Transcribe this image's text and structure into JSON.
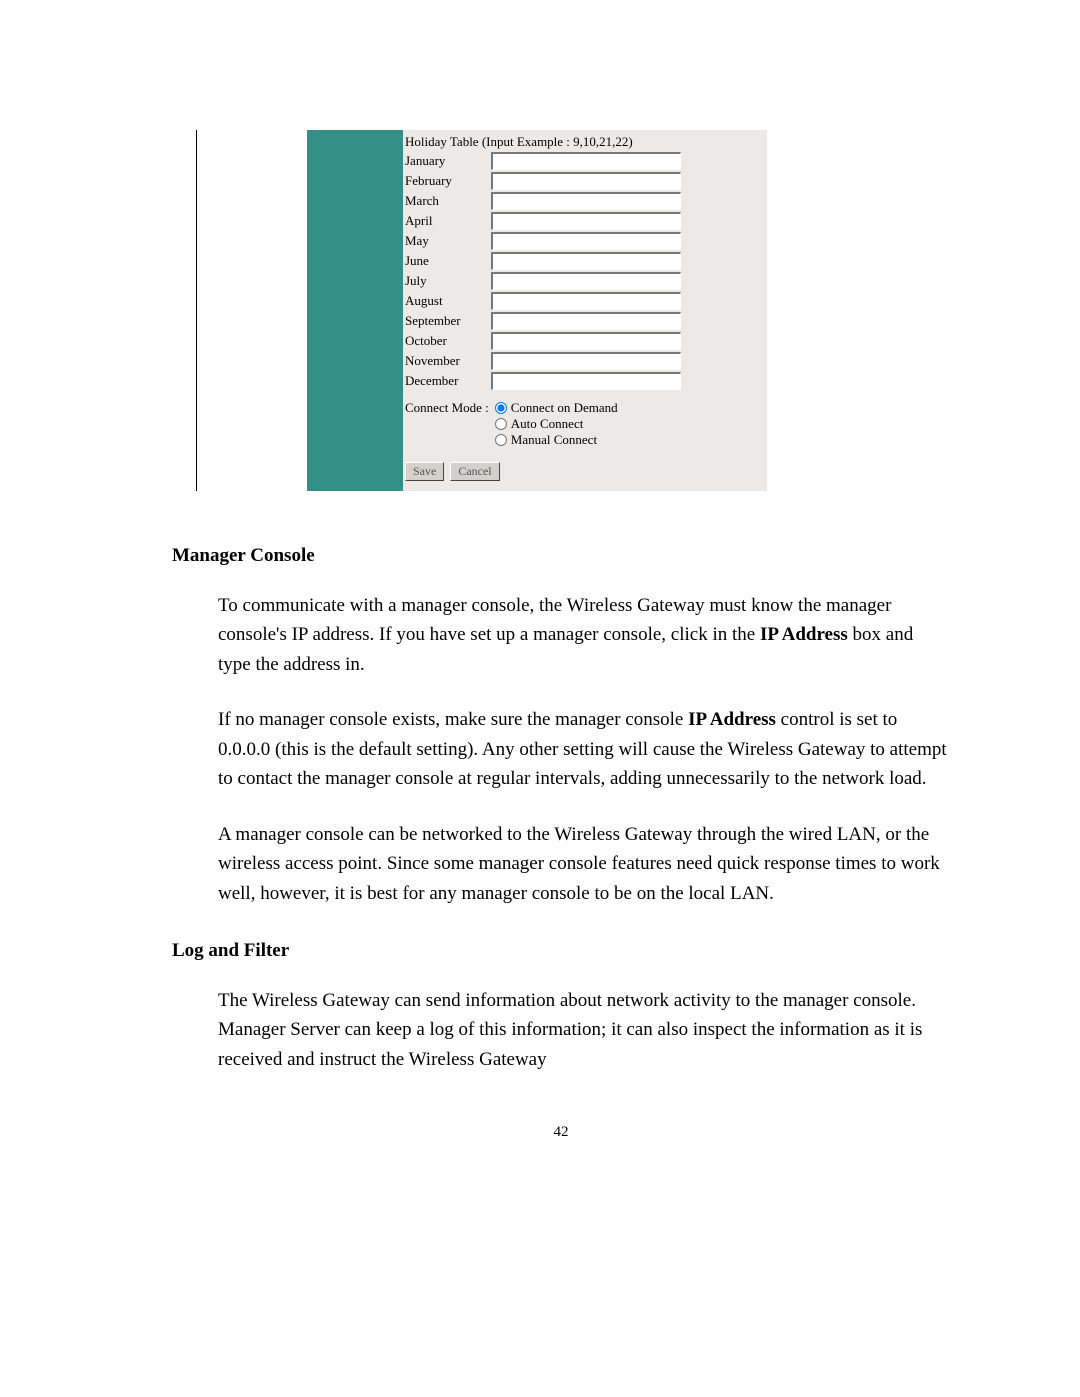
{
  "figure": {
    "holiday_title": "Holiday Table (Input Example : 9,10,21,22)",
    "months": [
      {
        "label": "January",
        "value": ""
      },
      {
        "label": "February",
        "value": ""
      },
      {
        "label": "March",
        "value": ""
      },
      {
        "label": "April",
        "value": ""
      },
      {
        "label": "May",
        "value": ""
      },
      {
        "label": "June",
        "value": ""
      },
      {
        "label": "July",
        "value": ""
      },
      {
        "label": "August",
        "value": ""
      },
      {
        "label": "September",
        "value": ""
      },
      {
        "label": "October",
        "value": ""
      },
      {
        "label": "November",
        "value": ""
      },
      {
        "label": "December",
        "value": ""
      }
    ],
    "connect_mode_label": "Connect Mode :",
    "connect_options": {
      "on_demand": "Connect on Demand",
      "auto": "Auto Connect",
      "manual": "Manual Connect"
    },
    "save_label": "Save",
    "cancel_label": "Cancel"
  },
  "sections": {
    "manager_console": {
      "heading": "Manager Console",
      "p1_a": "To communicate with a manager console, the Wireless Gateway must know the manager console's IP address. If you have set up a manager console, click in the ",
      "p1_bold": "IP Address",
      "p1_b": " box and type the address in.",
      "p2_a": "If no manager console exists, make sure the manager console ",
      "p2_bold": "IP Address",
      "p2_b": " control is set to 0.0.0.0 (this is the default setting). Any other setting will cause the Wireless Gateway to attempt to contact the manager console at regular intervals, adding unnecessarily to the network load.",
      "p3": "A manager console can be networked to the Wireless Gateway through the wired LAN, or the wireless access point. Since some manager console features need quick response times to work well, however, it is best for any manager console to be on the local LAN."
    },
    "log_and_filter": {
      "heading": "Log and Filter",
      "p1": "The Wireless Gateway can send information about network activity to the manager console. Manager Server can keep a log of this information; it can also inspect the information as it is received and instruct the Wireless Gateway"
    }
  },
  "page_number": "42"
}
